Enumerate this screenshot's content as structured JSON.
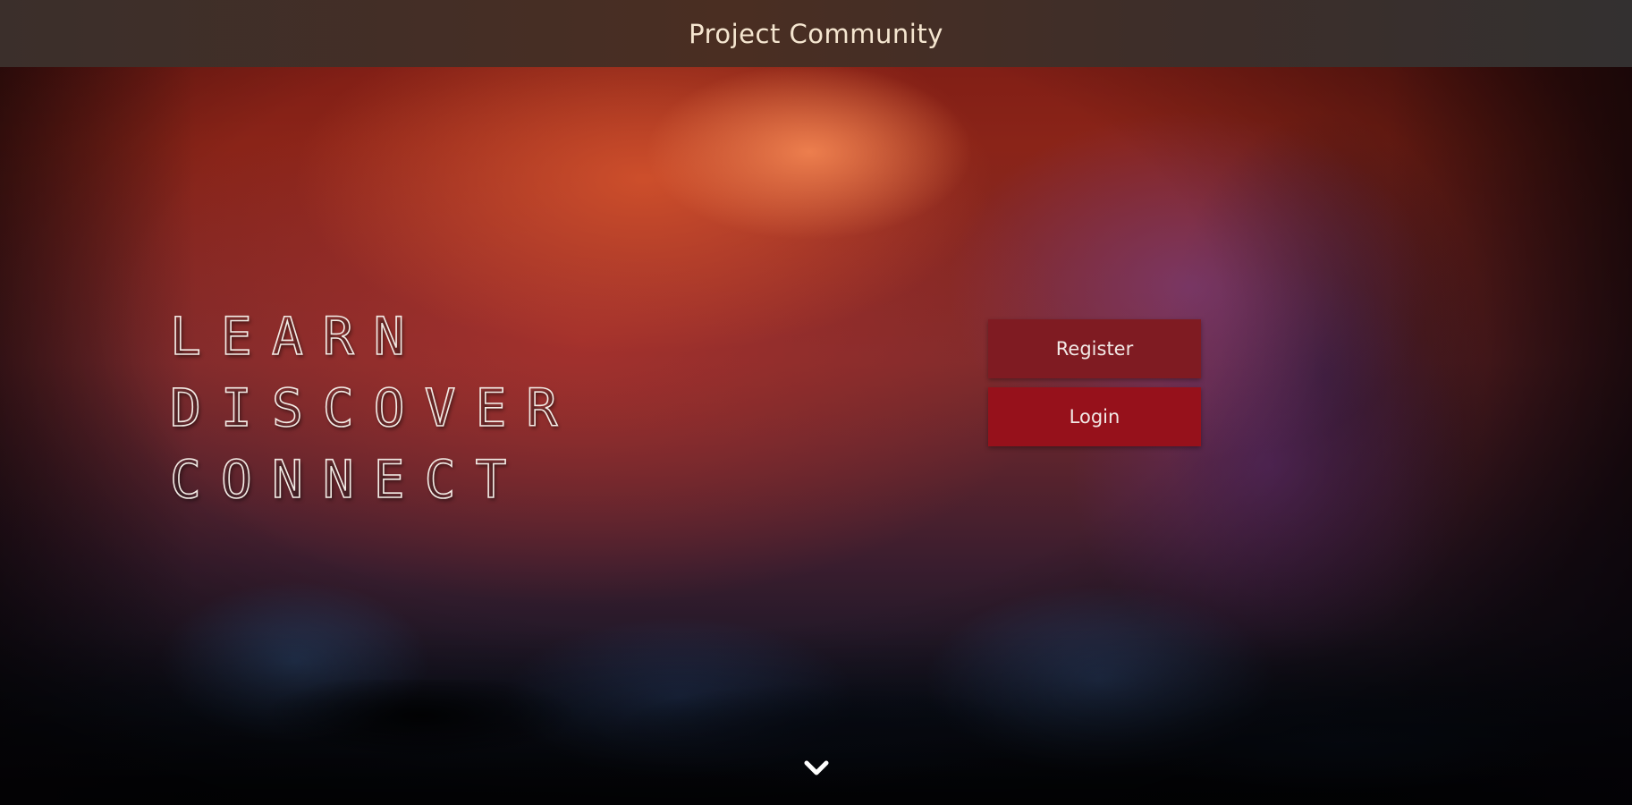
{
  "header": {
    "title": "Project Community"
  },
  "hero": {
    "tagline": [
      "LEARN",
      "DISCOVER",
      "CONNECT"
    ]
  },
  "auth": {
    "register_label": "Register",
    "login_label": "Login"
  },
  "scroll": {
    "icon": "chevron-down-icon"
  },
  "colors": {
    "header_text": "#f5e6d0",
    "register_button": "#7f1b22",
    "login_button": "#96111b",
    "tagline_text": "#f3ece6"
  }
}
